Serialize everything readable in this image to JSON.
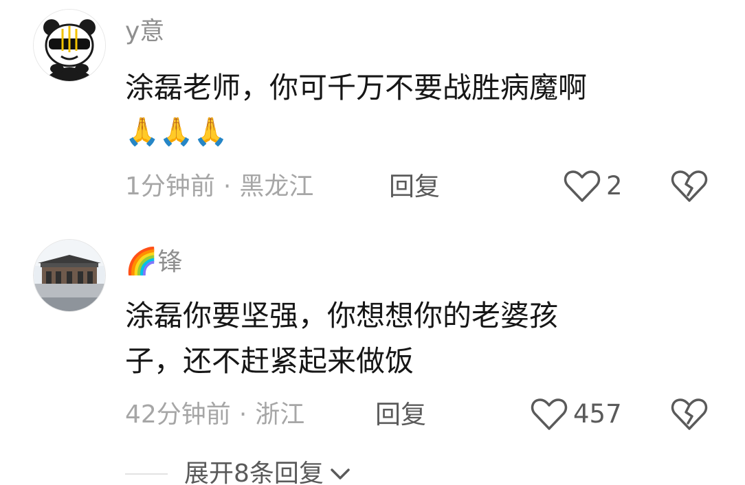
{
  "comments": [
    {
      "username": "y意",
      "content_lines": [
        "涂磊老师，你可千万不要战胜病魔啊"
      ],
      "emoji": "🙏🙏🙏",
      "time": "1分钟前",
      "location": "黑龙江",
      "reply_label": "回复",
      "likes": "2",
      "avatar_icon": "panda-avatar",
      "like_icon": "heart-outline-icon",
      "dislike_icon": "broken-heart-icon"
    },
    {
      "username_emoji": "🌈",
      "username": "锋",
      "content_lines": [
        "涂磊你要坚强，你想想你的老婆孩",
        "子，还不赶紧起来做饭"
      ],
      "time": "42分钟前",
      "location": "浙江",
      "reply_label": "回复",
      "likes": "457",
      "avatar_icon": "building-photo-avatar",
      "like_icon": "heart-outline-icon",
      "dislike_icon": "broken-heart-icon"
    }
  ],
  "meta_separator": "·",
  "expand": {
    "label": "展开8条回复",
    "icon": "chevron-down-icon"
  },
  "colors": {
    "text_primary": "#161616",
    "text_secondary": "#8f8f8f",
    "action": "#5a5a5a"
  }
}
